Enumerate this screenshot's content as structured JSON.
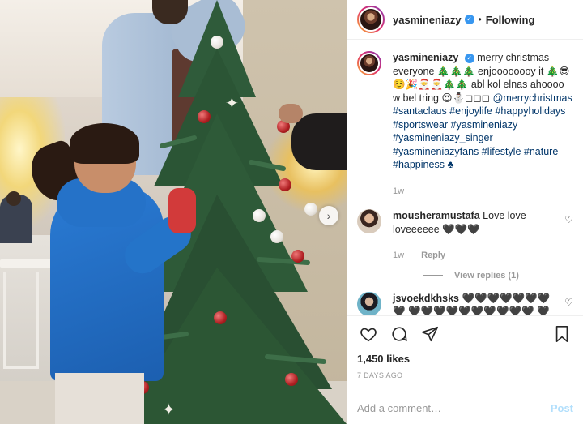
{
  "header": {
    "username": "yasmineniazy",
    "separator": "•",
    "follow_status": "Following"
  },
  "caption": {
    "username": "yasmineniazy",
    "text": "merry christmas everyone 🎄🎄🎄 enjoooooooy it 🎄😎 ☺️🎉🎅🎅🎄🎄 abl kol elnas ahoooo w bel tring 😍⛄◻◻◻",
    "mention": "@merrychristmas",
    "hashtags": "#santaclaus #enjoylife #happyholidays #sportswear #yasmineniazy #yasmineniazy_singer #yasmineniazyfans #lifestyle #nature #happiness ♣",
    "age": "1w"
  },
  "comments": [
    {
      "username": "mousheramustafa",
      "text": "Love love loveeeeee 🖤🖤🖤",
      "age": "1w",
      "reply_label": "Reply",
      "view_replies": "View replies (1)"
    },
    {
      "username": "jsvoekdkhsks",
      "text": "🖤🖤🖤🖤🖤🖤🖤🖤 🖤🖤🖤🖤🖤🖤🖤🖤🖤🖤 🖤🖤🖤"
    }
  ],
  "likes": "1,450 likes",
  "posted_ago": "7 DAYS AGO",
  "add_comment": {
    "placeholder": "Add a comment…",
    "post_label": "Post"
  },
  "icons": {
    "like": "heart-icon",
    "comment": "comment-icon",
    "share": "share-icon",
    "save": "bookmark-icon",
    "next": "chevron-right-icon",
    "verified": "verified-icon"
  },
  "colors": {
    "link": "#003569",
    "muted": "#999999",
    "verified": "#3897f0",
    "post_disabled": "#b2dffc"
  }
}
